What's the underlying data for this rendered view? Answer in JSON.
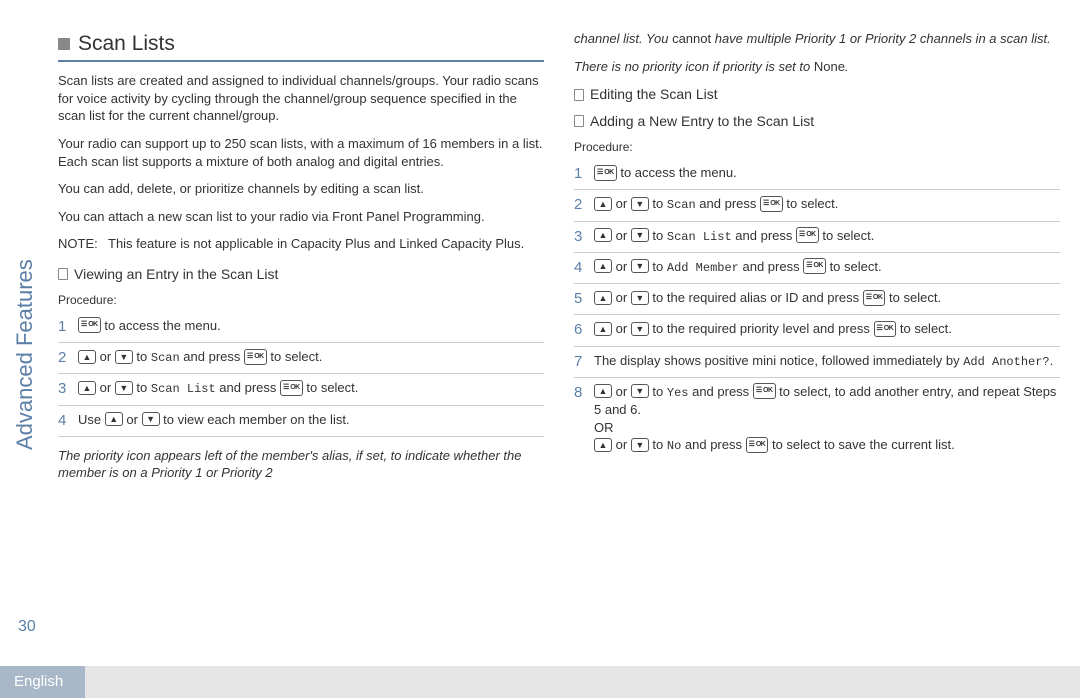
{
  "sidebar": {
    "verticalTitle": "Advanced Features",
    "pageNumber": "30"
  },
  "footer": {
    "language": "English"
  },
  "left": {
    "sectionTitle": "Scan Lists",
    "p1": "Scan lists are created and assigned to individual channels/groups. Your radio scans for voice activity by cycling through the channel/group sequence specified in the scan list for the current channel/group.",
    "p2": "Your radio can support up to 250 scan lists, with a maximum of 16 members in a list. Each scan list supports a mixture of both analog and digital entries.",
    "p3": "You can add, delete, or prioritize channels by editing a scan list.",
    "p4": "You can attach a new scan list to your radio via Front Panel Programming.",
    "noteLabel": "NOTE:",
    "noteBody": "This feature is not applicable in Capacity Plus and Linked Capacity Plus.",
    "subhead1": "Viewing an Entry in the Scan List",
    "procLabel": "Procedure:",
    "steps": [
      {
        "n": "1",
        "a": " to access the menu."
      },
      {
        "n": "2",
        "pre": "",
        "mid1": " or ",
        "mono": "Scan",
        "mid2": " and press ",
        "post": " to select."
      },
      {
        "n": "3",
        "pre": "",
        "mid1": " or ",
        "mono": "Scan List",
        "mid2": " and press ",
        "post": " to select."
      },
      {
        "n": "4",
        "pre": "Use ",
        "mid1": " or ",
        "post": " to view each member on the list."
      }
    ],
    "footnote": "The priority icon appears left of the member's alias, if set, to indicate whether the member is on a Priority 1 or Priority 2"
  },
  "right": {
    "cont1a": "channel list. You ",
    "cont1b": "cannot",
    "cont1c": " have multiple Priority 1 or Priority 2 channels in a scan list.",
    "cont2a": "There is no priority icon if priority is set to ",
    "cont2b": "None",
    "cont2c": ".",
    "subhead2": "Editing the Scan List",
    "subhead3": "Adding a New Entry to the Scan List",
    "procLabel": "Procedure:",
    "steps": [
      {
        "n": "1",
        "a": " to access the menu."
      },
      {
        "n": "2",
        "mid1": " or ",
        "mono": "Scan",
        "mid2": " and press ",
        "post": " to select."
      },
      {
        "n": "3",
        "mid1": " or ",
        "mono": "Scan List",
        "mid2": " and press ",
        "post": " to select."
      },
      {
        "n": "4",
        "mid1": " or ",
        "mono": "Add Member",
        "mid2": " and press ",
        "post": " to select."
      },
      {
        "n": "5",
        "mid1": " or ",
        "plain": " to the required alias or ID and press ",
        "post": " to select."
      },
      {
        "n": "6",
        "mid1": " or ",
        "plain": " to the required priority level and press ",
        "post": " to select."
      },
      {
        "n": "7",
        "text1": "The display shows positive mini notice, followed immediately by ",
        "mono": "Add Another?",
        "text2": "."
      },
      {
        "n": "8",
        "line1_mid1": " or ",
        "line1_mono": "Yes",
        "line1_mid2": " and press ",
        "line1_post": " to select, to add another entry, and repeat Steps 5 and 6.",
        "or": "OR",
        "line2_mid1": " or ",
        "line2_mono": "No",
        "line2_mid2": " and press ",
        "line2_post": " to select to save the current list."
      }
    ]
  }
}
